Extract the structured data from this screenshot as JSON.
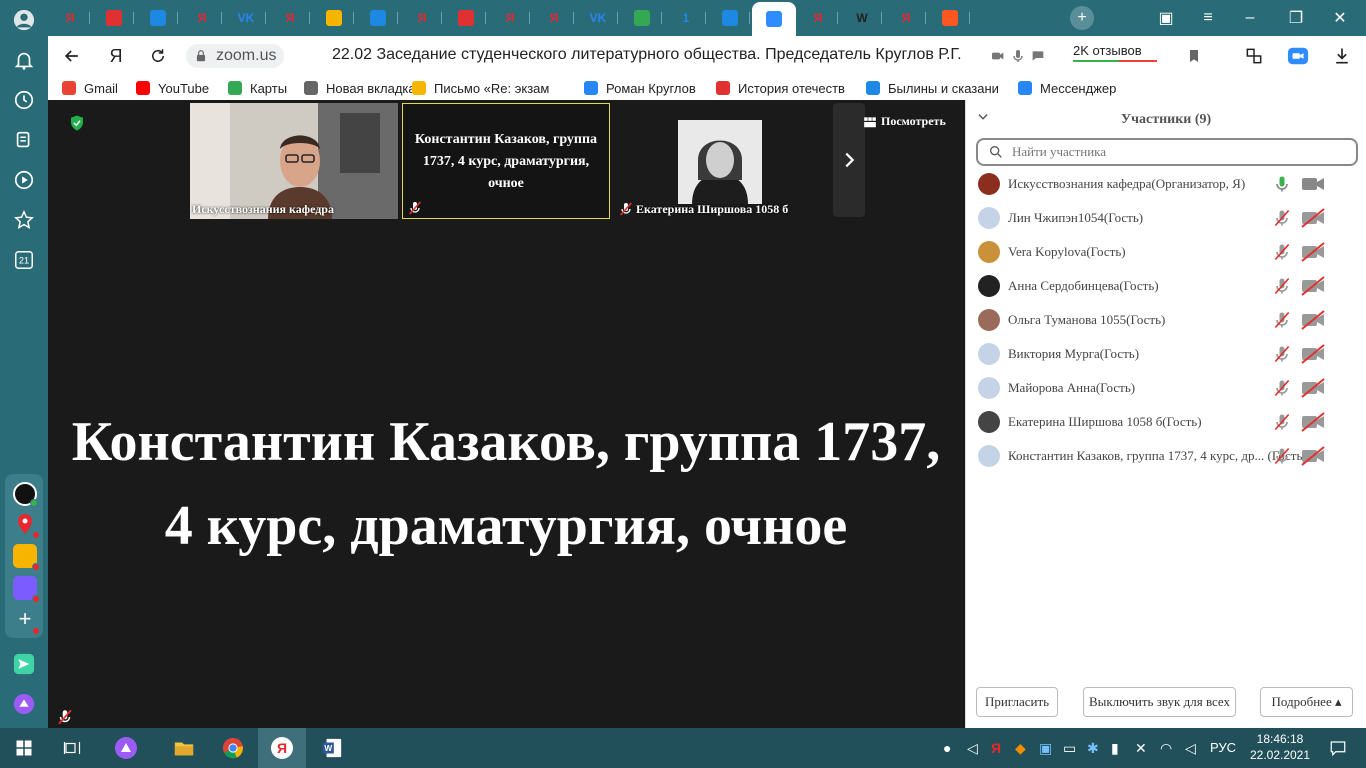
{
  "browser": {
    "address": "zoom.us",
    "page_title": "22.02 Заседание студенческого литературного общества. Председатель Круглов Р.Г.",
    "reviews_label": "2K отзывов",
    "yandex_letter": "Я"
  },
  "tabs": [
    {
      "icon": "yandex-icon",
      "letter": "Я",
      "color": "#e8262e"
    },
    {
      "icon": "calendar-icon",
      "letter": "",
      "color": "#e03131"
    },
    {
      "icon": "pause-icon",
      "letter": "",
      "color": "#1e88e5"
    },
    {
      "icon": "yandex-icon",
      "letter": "Я",
      "color": "#e8262e"
    },
    {
      "icon": "vk-icon",
      "letter": "VK",
      "color": "#2787f5"
    },
    {
      "icon": "yandex-icon",
      "letter": "Я",
      "color": "#e8262e"
    },
    {
      "icon": "mail-icon",
      "letter": "",
      "color": "#f7b500"
    },
    {
      "icon": "document-icon",
      "letter": "",
      "color": "#1e88e5"
    },
    {
      "icon": "yandex-icon",
      "letter": "Я",
      "color": "#e8262e"
    },
    {
      "icon": "pdf-icon",
      "letter": "",
      "color": "#e03131"
    },
    {
      "icon": "yandex-icon",
      "letter": "Я",
      "color": "#e8262e"
    },
    {
      "icon": "yandex-icon",
      "letter": "Я",
      "color": "#e8262e"
    },
    {
      "icon": "vk-icon",
      "letter": "VK",
      "color": "#2787f5"
    },
    {
      "icon": "chrome-icon",
      "letter": "",
      "color": "#34a853"
    },
    {
      "icon": "number-icon",
      "letter": "1",
      "color": "#1e88e5"
    },
    {
      "icon": "chat-icon",
      "letter": "",
      "color": "#1e88e5"
    },
    {
      "icon": "zoom-icon",
      "letter": "",
      "color": "#2d8cff"
    },
    {
      "icon": "yandex-icon",
      "letter": "Я",
      "color": "#e8262e"
    },
    {
      "icon": "wikipedia-icon",
      "letter": "W",
      "color": "#222222"
    },
    {
      "icon": "yandex-icon",
      "letter": "Я",
      "color": "#e8262e"
    },
    {
      "icon": "app-icon",
      "letter": "",
      "color": "#ff5722"
    }
  ],
  "bookmarks": [
    {
      "label": "Gmail",
      "color": "#ea4335"
    },
    {
      "label": "YouTube",
      "color": "#ff0000"
    },
    {
      "label": "Карты",
      "color": "#34a853"
    },
    {
      "label": "Новая вкладка",
      "color": "#666666"
    },
    {
      "label": "Письмо «Re: экзам",
      "color": "#f7b500"
    },
    {
      "label": "Роман Круглов",
      "color": "#2787f5"
    },
    {
      "label": "История отечеств",
      "color": "#e03131"
    },
    {
      "label": "Былины и сказани",
      "color": "#1e88e5"
    },
    {
      "label": "Мессенджер",
      "color": "#2787f5"
    }
  ],
  "sidebar": {
    "badge_number": "21"
  },
  "zoom": {
    "thumbnails": [
      {
        "name": "Искусствознания кафедра"
      },
      {
        "name": "Константин Казаков, группа 1737, 4 курс, драматургия, очное"
      },
      {
        "name": "Екатерина Ширшова 1058 б"
      }
    ],
    "view_label": "Посмотреть",
    "main_title": "Константин Казаков, группа 1737, 4 курс, драматургия, очное"
  },
  "participants": {
    "title": "Участники (9)",
    "search_placeholder": "Найти участника",
    "items": [
      {
        "name": "Искусствознания кафедра(Организатор, Я)",
        "avatar_color": "#8b2e1f",
        "muted": false
      },
      {
        "name": "Лин Чжипэн1054(Гость)",
        "avatar_color": "#c5d3e6",
        "muted": true
      },
      {
        "name": "Vera Kopylova(Гость)",
        "avatar_color": "#c9923a",
        "muted": true
      },
      {
        "name": "Анна Сердобинцева(Гость)",
        "avatar_color": "#222222",
        "muted": true
      },
      {
        "name": "Ольга Туманова 1055(Гость)",
        "avatar_color": "#9a6b5a",
        "muted": true
      },
      {
        "name": "Виктория Мурга(Гость)",
        "avatar_color": "#c5d3e6",
        "muted": true
      },
      {
        "name": "Майорова Анна(Гость)",
        "avatar_color": "#c5d3e6",
        "muted": true
      },
      {
        "name": "Екатерина Ширшова 1058 б(Гость)",
        "avatar_color": "#444444",
        "muted": true
      },
      {
        "name": "Константин Казаков, группа 1737, 4 курс, др...  (Гость)",
        "avatar_color": "#c5d3e6",
        "muted": true
      }
    ],
    "invite_label": "Пригласить",
    "mute_all_label": "Выключить звук для всех",
    "more_label": "Подробнее ▴"
  },
  "taskbar": {
    "lang": "РУС",
    "time": "18:46:18",
    "date": "22.02.2021",
    "word_letter": "W"
  }
}
